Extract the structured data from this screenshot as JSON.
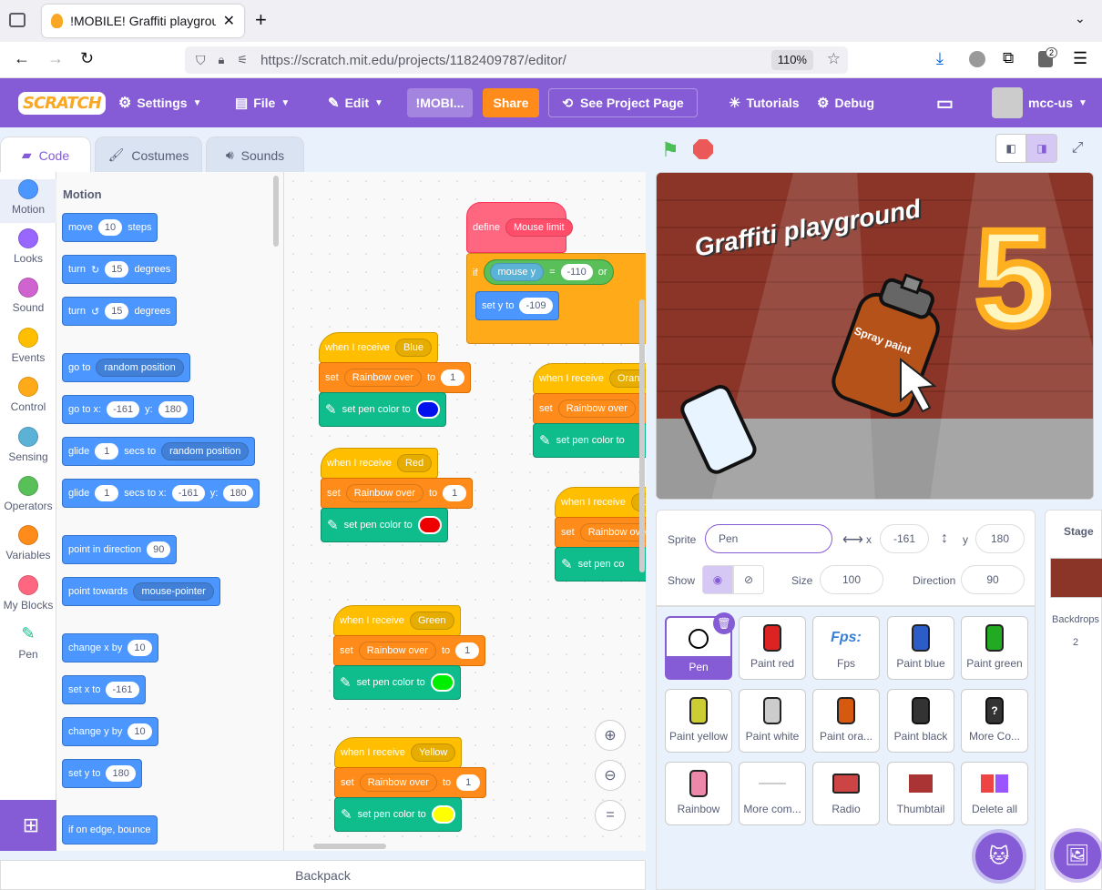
{
  "browser": {
    "tab_title": "!MOBILE! Graffiti playground",
    "url": "https://scratch.mit.edu/projects/1182409787/editor/",
    "zoom": "110%",
    "download_badge": "2"
  },
  "menu": {
    "logo": "SCRATCH",
    "settings": "Settings",
    "file": "File",
    "edit": "Edit",
    "project_title": "!MOBI...",
    "share": "Share",
    "see_project": "See Project Page",
    "tutorials": "Tutorials",
    "debug": "Debug",
    "username": "mcc-us"
  },
  "editor_tabs": {
    "code": "Code",
    "costumes": "Costumes",
    "sounds": "Sounds"
  },
  "categories": [
    {
      "label": "Motion",
      "color": "#4c97ff"
    },
    {
      "label": "Looks",
      "color": "#9966ff"
    },
    {
      "label": "Sound",
      "color": "#cf63cf"
    },
    {
      "label": "Events",
      "color": "#ffbf00"
    },
    {
      "label": "Control",
      "color": "#ffab19"
    },
    {
      "label": "Sensing",
      "color": "#5cb1d6"
    },
    {
      "label": "Operators",
      "color": "#59c059"
    },
    {
      "label": "Variables",
      "color": "#ff8c1a"
    },
    {
      "label": "My Blocks",
      "color": "#ff6680"
    },
    {
      "label": "Pen",
      "color": "#0fbd8c"
    }
  ],
  "palette": {
    "heading": "Motion",
    "move": {
      "a": "move",
      "v": "10",
      "b": "steps"
    },
    "turn_right": {
      "a": "turn",
      "v": "15",
      "b": "degrees"
    },
    "turn_left": {
      "a": "turn",
      "v": "15",
      "b": "degrees"
    },
    "goto": {
      "a": "go to",
      "menu": "random position"
    },
    "goto_xy": {
      "a": "go to x:",
      "x": "-161",
      "b": "y:",
      "y": "180"
    },
    "glide_random": {
      "a": "glide",
      "v": "1",
      "b": "secs to",
      "menu": "random position"
    },
    "glide_xy": {
      "a": "glide",
      "v": "1",
      "b": "secs to x:",
      "x": "-161",
      "c": "y:",
      "y": "180"
    },
    "point_dir": {
      "a": "point in direction",
      "v": "90"
    },
    "point_towards": {
      "a": "point towards",
      "menu": "mouse-pointer"
    },
    "change_x": {
      "a": "change x by",
      "v": "10"
    },
    "set_x": {
      "a": "set x to",
      "v": "-161"
    },
    "change_y": {
      "a": "change y by",
      "v": "10"
    },
    "set_y": {
      "a": "set y to",
      "v": "180"
    },
    "bounce": "if on edge, bounce"
  },
  "scripts": {
    "define": {
      "a": "define",
      "name": "Mouse limit"
    },
    "if": {
      "a": "if",
      "reporter": "mouse y",
      "op": "=",
      "value": "-110",
      "or": "or"
    },
    "sety": {
      "a": "set y to",
      "v": "-109"
    },
    "common": {
      "when_receive": "when I receive",
      "set": "set",
      "var": "Rainbow over",
      "to": "to",
      "one": "1",
      "pen_color": "set pen color to"
    },
    "blue": {
      "msg": "Blue",
      "color": "#0011ee"
    },
    "red": {
      "msg": "Red",
      "color": "#ee0000"
    },
    "green": {
      "msg": "Green",
      "color": "#00ee00"
    },
    "yellow": {
      "msg": "Yellow",
      "color": "#ffff00"
    },
    "orange": {
      "msg": "Orang",
      "color": "#ff8800"
    },
    "e_partial": {
      "msg": "E"
    },
    "pen_partial": "set pen co"
  },
  "stage": {
    "title": "Graffiti playground",
    "can_text": "Spray paint",
    "fps_number": "5"
  },
  "sprite_info": {
    "sprite_label": "Sprite",
    "sprite_name": "Pen",
    "x_label": "x",
    "x": "-161",
    "y_label": "y",
    "y": "180",
    "show_label": "Show",
    "size_label": "Size",
    "size": "100",
    "direction_label": "Direction",
    "direction": "90"
  },
  "sprites": [
    {
      "name": "Pen",
      "icon": "circle-icon",
      "selected": true
    },
    {
      "name": "Paint red",
      "icon": "spray-can-red-icon",
      "color": "#d22"
    },
    {
      "name": "Fps",
      "icon": "fps-text-icon",
      "thumb_text": "Fps:"
    },
    {
      "name": "Paint blue",
      "icon": "spray-can-blue-icon",
      "color": "#2c5cc8"
    },
    {
      "name": "Paint green",
      "icon": "spray-can-green-icon",
      "color": "#2a2"
    },
    {
      "name": "Paint yellow",
      "icon": "spray-can-yellow-icon",
      "color": "#cc3"
    },
    {
      "name": "Paint white",
      "icon": "spray-can-white-icon",
      "color": "#ccc"
    },
    {
      "name": "Paint ora...",
      "icon": "spray-can-orange-icon",
      "color": "#d55a10"
    },
    {
      "name": "Paint black",
      "icon": "spray-can-black-icon",
      "color": "#333"
    },
    {
      "name": "More Co...",
      "icon": "spray-can-question-icon",
      "color": "#333"
    },
    {
      "name": "Rainbow",
      "icon": "spray-can-rainbow-icon",
      "color": "#e8a"
    },
    {
      "name": "More com...",
      "icon": "dash-line-icon",
      "color": "#bbb"
    },
    {
      "name": "Radio",
      "icon": "radio-icon",
      "color": "#c44"
    },
    {
      "name": "Thumbtail",
      "icon": "thumbnail-icon",
      "color": "#a33"
    },
    {
      "name": "Delete all",
      "icon": "paint-swatch-icon",
      "color": "#e44"
    }
  ],
  "stage_panel": {
    "label": "Stage",
    "backdrops_label": "Backdrops",
    "backdrops_count": "2"
  },
  "backpack": "Backpack"
}
